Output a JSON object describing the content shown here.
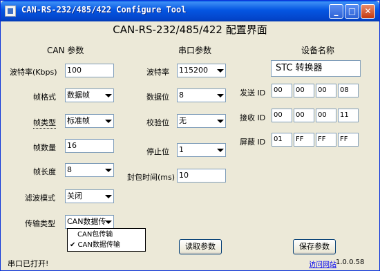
{
  "window": {
    "title": "CAN-RS-232/485/422 Configure Tool",
    "minimize": "_",
    "maximize": "□",
    "close": "✕"
  },
  "heading": "CAN-RS-232/485/422 配置界面",
  "can": {
    "group_title": "CAN 参数",
    "baud_label": "波特率(Kbps)",
    "baud_value": "100",
    "frame_format_label": "帧格式",
    "frame_format_value": "数据帧",
    "frame_type_label": "帧类型",
    "frame_type_value": "标准帧",
    "frame_count_label": "帧数量",
    "frame_count_value": "16",
    "frame_len_label": "帧长度",
    "frame_len_value": "8",
    "filter_label": "滤波模式",
    "filter_value": "关闭",
    "transfer_label": "传输类型",
    "transfer_value": "CAN数据传",
    "transfer_options": [
      "CAN包传输",
      "✔ CAN数据传输"
    ]
  },
  "serial": {
    "group_title": "串口参数",
    "baud_label": "波特率",
    "baud_value": "115200",
    "databits_label": "数据位",
    "databits_value": "8",
    "parity_label": "校验位",
    "parity_value": "无",
    "stopbits_label": "停止位",
    "stopbits_value": "1",
    "packet_time_label": "封包时间(ms)",
    "packet_time_value": "10"
  },
  "device": {
    "group_title": "设备名称",
    "name_value": "STC 转换器",
    "send_label": "发送 ID",
    "send_ids": [
      "00",
      "00",
      "00",
      "08"
    ],
    "recv_label": "接收 ID",
    "recv_ids": [
      "00",
      "00",
      "00",
      "11"
    ],
    "mask_label": "屏蔽 ID",
    "mask_ids": [
      "01",
      "FF",
      "FF",
      "FF"
    ]
  },
  "buttons": {
    "read": "读取参数",
    "save": "保存参数"
  },
  "status": "串口已打开!",
  "link": "访问网站",
  "version": "1.0.0.58"
}
